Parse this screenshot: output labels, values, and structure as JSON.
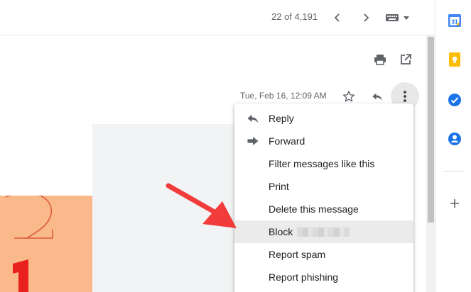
{
  "toolbar": {
    "counter": "22 of 4,191",
    "prev_icon": "chevron-left-icon",
    "next_icon": "chevron-right-icon",
    "input_tools_icon": "keyboard-icon"
  },
  "message": {
    "date": "Tue, Feb 16, 12:09 AM",
    "print_icon": "print-icon",
    "popout_icon": "open-in-new-window-icon",
    "star_icon": "star-icon",
    "reply_icon": "reply-icon",
    "more_icon": "more-vert-icon"
  },
  "menu": {
    "items": [
      {
        "label": "Reply",
        "icon": "reply-icon"
      },
      {
        "label": "Forward",
        "icon": "forward-icon"
      },
      {
        "label": "Filter messages like this"
      },
      {
        "label": "Print"
      },
      {
        "label": "Delete this message"
      },
      {
        "label": "Block",
        "highlighted": true
      },
      {
        "label": "Report spam"
      },
      {
        "label": "Report phishing"
      }
    ]
  },
  "side_panel": {
    "calendar_label": "31",
    "icons": [
      "calendar-icon",
      "keep-icon",
      "tasks-icon",
      "contacts-icon",
      "add-icon"
    ]
  },
  "colors": {
    "accent_arrow": "#f23b3b",
    "menu_highlight": "#ebebeb",
    "orange_image": "#f9b98a"
  }
}
